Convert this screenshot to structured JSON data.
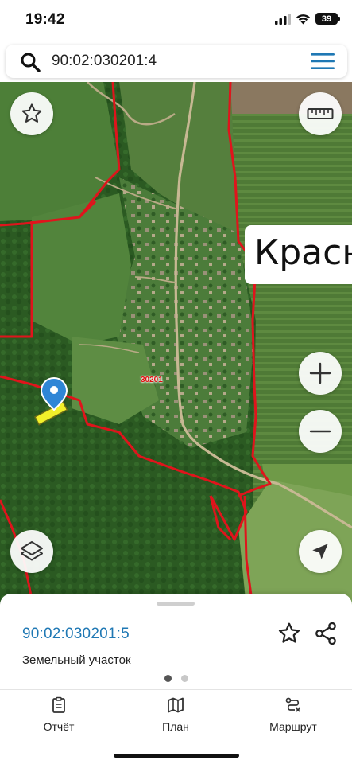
{
  "status_bar": {
    "time": "19:42",
    "battery": "39",
    "icons": [
      "signal-icon",
      "wifi-icon",
      "battery-icon"
    ]
  },
  "search": {
    "value": "90:02:030201:4",
    "icon": "search-icon",
    "menu_icon": "hamburger-menu-icon"
  },
  "map": {
    "place_label": "Краснолесье",
    "quarter_label": "30201",
    "colors": {
      "boundary": "#e0141c",
      "selected_parcel": "#f2f02a",
      "marker": "#2f86d6"
    },
    "controls": [
      "favorite-star-icon",
      "ruler-icon",
      "zoom-in-icon",
      "zoom-out-icon",
      "layers-icon",
      "location-arrow-icon"
    ]
  },
  "sheet": {
    "parcel_id": "90:02:030201:5",
    "parcel_type": "Земельный участок",
    "pages": 2,
    "active_page": 1
  },
  "tabs": [
    {
      "label": "Отчёт",
      "icon": "report-icon"
    },
    {
      "label": "План",
      "icon": "map-plan-icon"
    },
    {
      "label": "Маршрут",
      "icon": "route-icon"
    }
  ],
  "accent_color": "#1f78b4"
}
